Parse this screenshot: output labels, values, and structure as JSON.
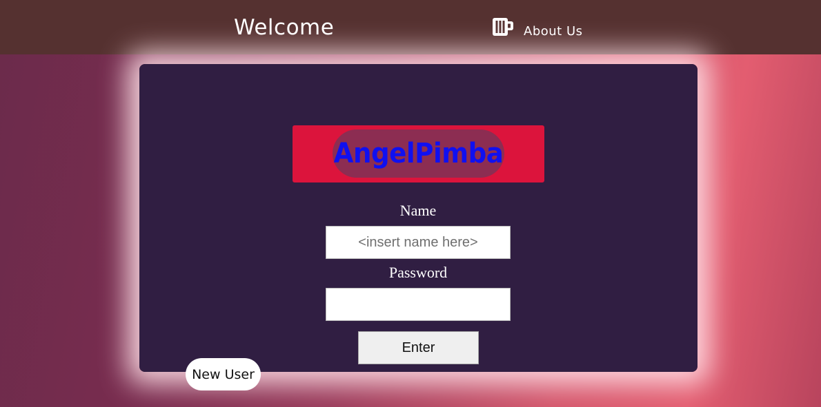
{
  "header": {
    "title": "Welcome",
    "about_label": "About Us",
    "about_icon": "beer-mug-icon",
    "background_color": "#553130"
  },
  "card": {
    "background_color": "#301e42",
    "logo": {
      "text": "AngelPimba",
      "box_color": "#dc143c",
      "pill_color": "#8c2d52",
      "text_color": "#1010f0"
    },
    "name_label": "Name",
    "name_placeholder": "<insert name here>",
    "name_value": "",
    "password_label": "Password",
    "password_value": "",
    "enter_label": "Enter"
  },
  "new_user_label": "New User"
}
